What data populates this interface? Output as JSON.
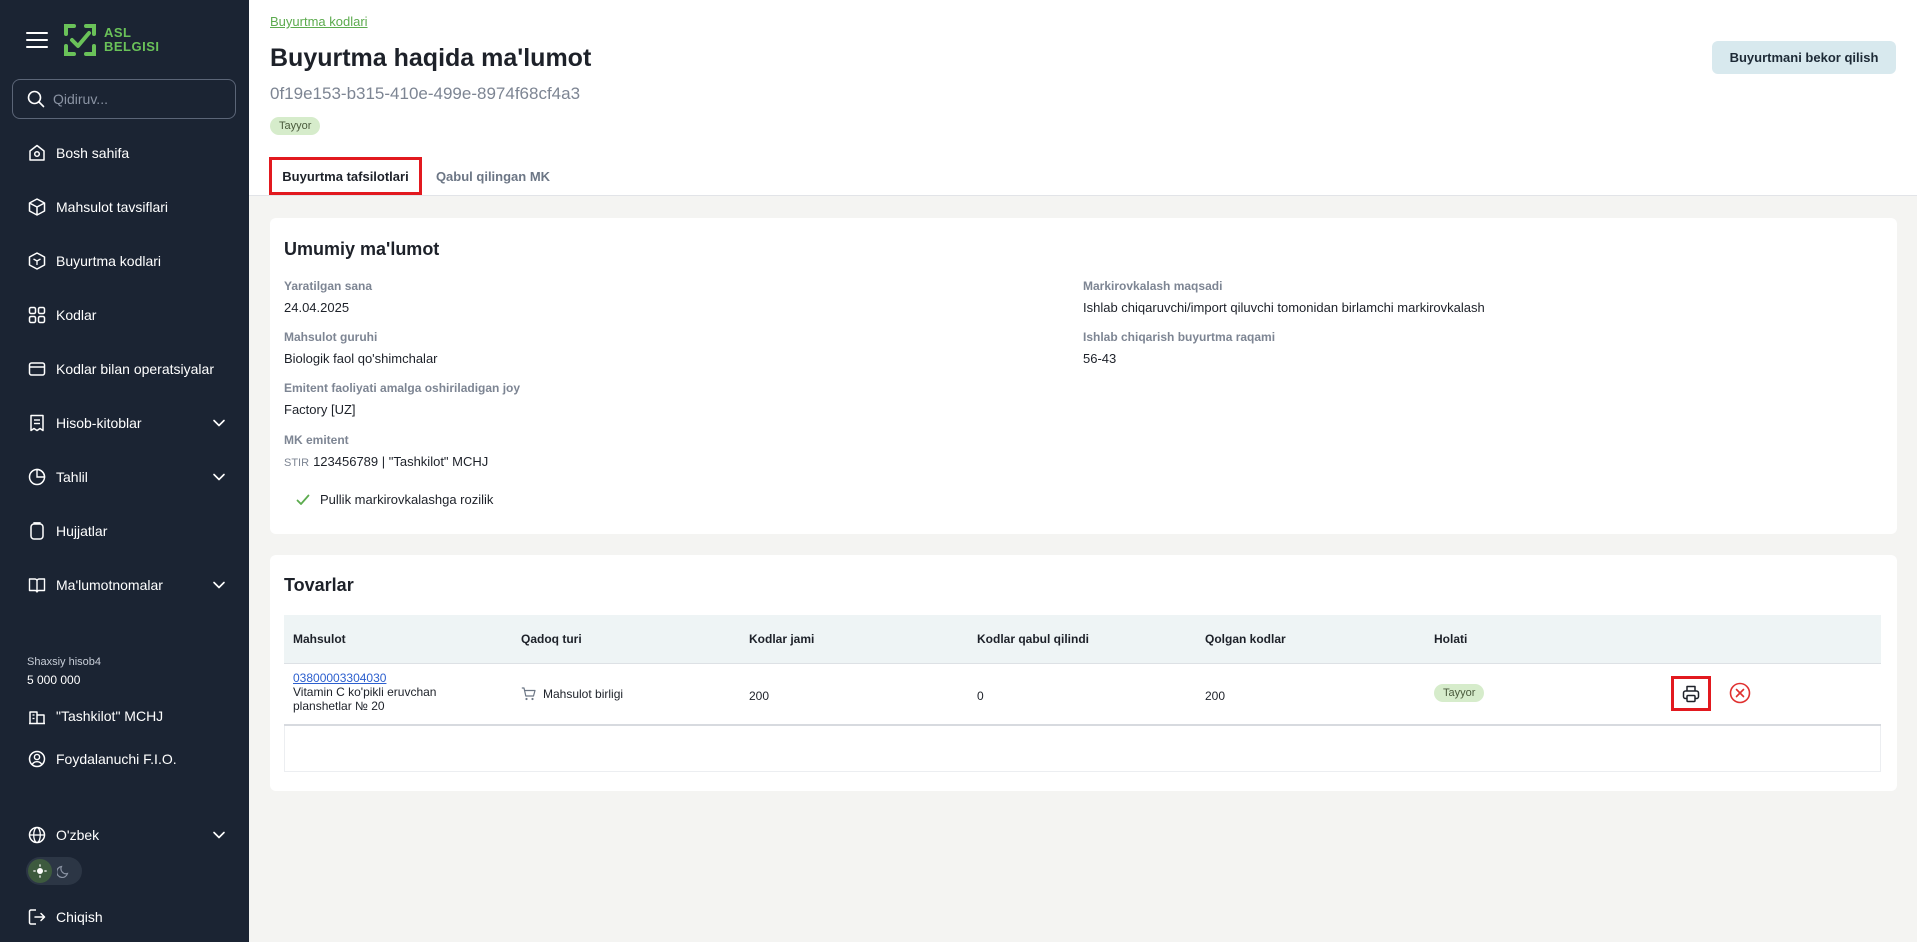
{
  "sidebar": {
    "logo_line1": "ASL",
    "logo_line2": "BELGISI",
    "search_placeholder": "Qidiruv...",
    "items": [
      {
        "label": "Bosh sahifa",
        "icon": "home-icon"
      },
      {
        "label": "Mahsulot tavsiflari",
        "icon": "box-icon"
      },
      {
        "label": "Buyurtma kodlari",
        "icon": "box-code-icon"
      },
      {
        "label": "Kodlar",
        "icon": "qr-icon"
      },
      {
        "label": "Kodlar bilan operatsiyalar",
        "icon": "operations-icon"
      },
      {
        "label": "Hisob-kitoblar",
        "icon": "receipt-icon"
      },
      {
        "label": "Tahlil",
        "icon": "chart-icon"
      },
      {
        "label": "Hujjatlar",
        "icon": "documents-icon"
      },
      {
        "label": "Ma'lumotnomalar",
        "icon": "book-icon"
      }
    ],
    "account_label": "Shaxsiy hisob4",
    "account_balance": "5 000 000",
    "company": "\"Tashkilot\" MCHJ",
    "user": "Foydalanuchi F.I.O.",
    "language": "O'zbek",
    "exit": "Chiqish"
  },
  "header": {
    "breadcrumb": "Buyurtma kodlari",
    "title": "Buyurtma haqida ma'lumot",
    "order_id": "0f19e153-b315-410e-499e-8974f68cf4a3",
    "status": "Tayyor",
    "cancel_button": "Buyurtmani bekor qilish",
    "tabs": [
      "Buyurtma tafsilotlari",
      "Qabul qilingan MK"
    ]
  },
  "general": {
    "title": "Umumiy ma'lumot",
    "created_label": "Yaratilgan sana",
    "created_value": "24.04.2025",
    "group_label": "Mahsulot guruhi",
    "group_value": "Biologik faol qo'shimchalar",
    "place_label": "Emitent faoliyati amalga oshiriladigan joy",
    "place_value": "Factory [UZ]",
    "emitent_label": "MK emitent",
    "emitent_prefix": "STIR",
    "emitent_value": "123456789 | \"Tashkilot\" MCHJ",
    "purpose_label": "Markirovkalash maqsadi",
    "purpose_value": "Ishlab chiqaruvchi/import qiluvchi tomonidan birlamchi markirovkalash",
    "prod_order_label": "Ishlab chiqarish buyurtma raqami",
    "prod_order_value": "56-43",
    "consent": "Pullik markirovkalashga rozilik"
  },
  "goods": {
    "title": "Tovarlar",
    "columns": [
      "Mahsulot",
      "Qadoq turi",
      "Kodlar jami",
      "Kodlar qabul qilindi",
      "Qolgan kodlar",
      "Holati"
    ],
    "rows": [
      {
        "code": "03800003304030",
        "name_line1": "Vitamin C ko'pikli eruvchan",
        "name_line2": "planshetlar № 20",
        "package": "Mahsulot birligi",
        "total": "200",
        "received": "0",
        "remaining": "200",
        "status": "Tayyor"
      }
    ]
  },
  "colors": {
    "sidebar_bg": "#1b2433",
    "accent_green": "#6ac259",
    "highlight_red": "#e2191f",
    "badge_bg": "#d6eccb"
  }
}
